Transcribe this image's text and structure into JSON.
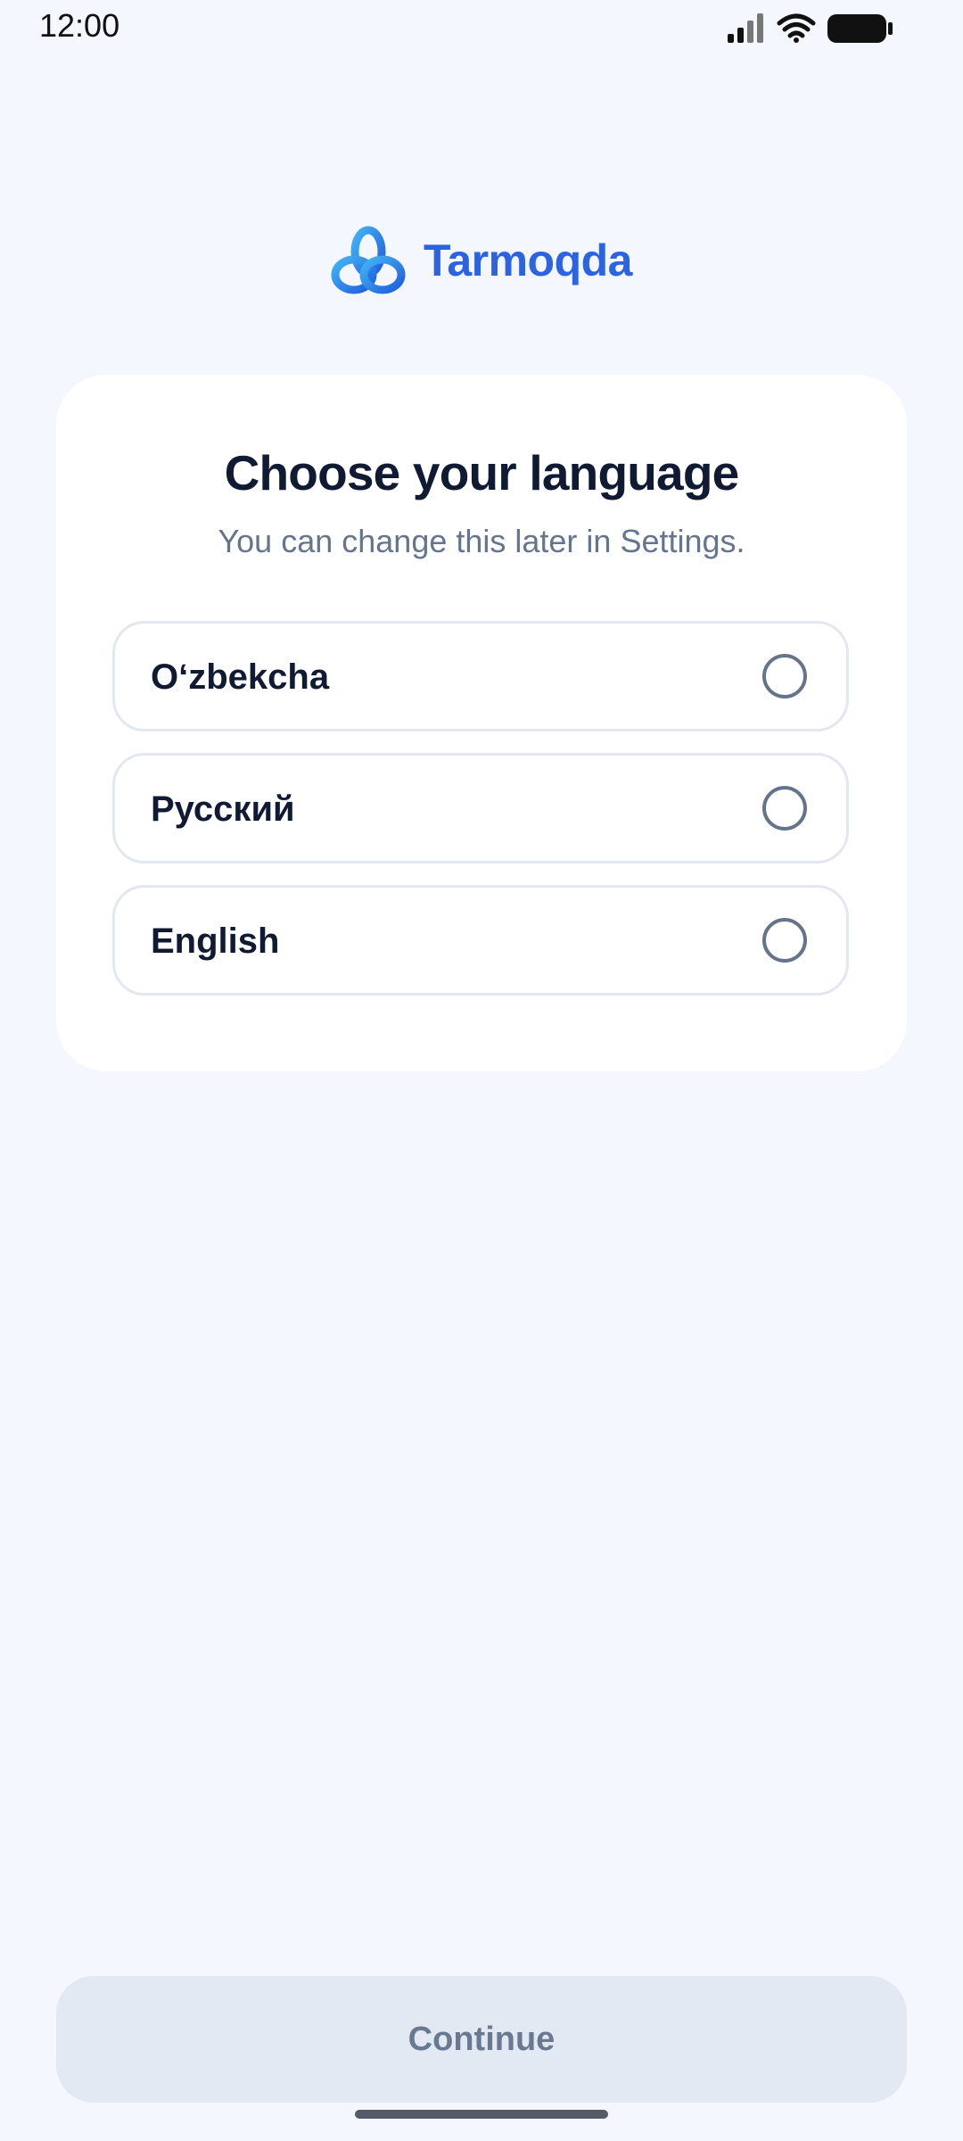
{
  "status_bar": {
    "time": "12:00",
    "icons": [
      "signal-icon",
      "wifi-icon",
      "battery-icon"
    ]
  },
  "brand": {
    "name": "Tarmoqda",
    "logo_icon": "trefoil-knot-logo",
    "color": "#2b63e3"
  },
  "language_card": {
    "title": "Choose your language",
    "subtitle": "You can change this later in Settings.",
    "options": [
      {
        "label": "O‘zbekcha",
        "selected": false
      },
      {
        "label": "Русский",
        "selected": false
      },
      {
        "label": "English",
        "selected": false
      }
    ]
  },
  "footer": {
    "continue_label": "Continue",
    "continue_enabled": false
  }
}
